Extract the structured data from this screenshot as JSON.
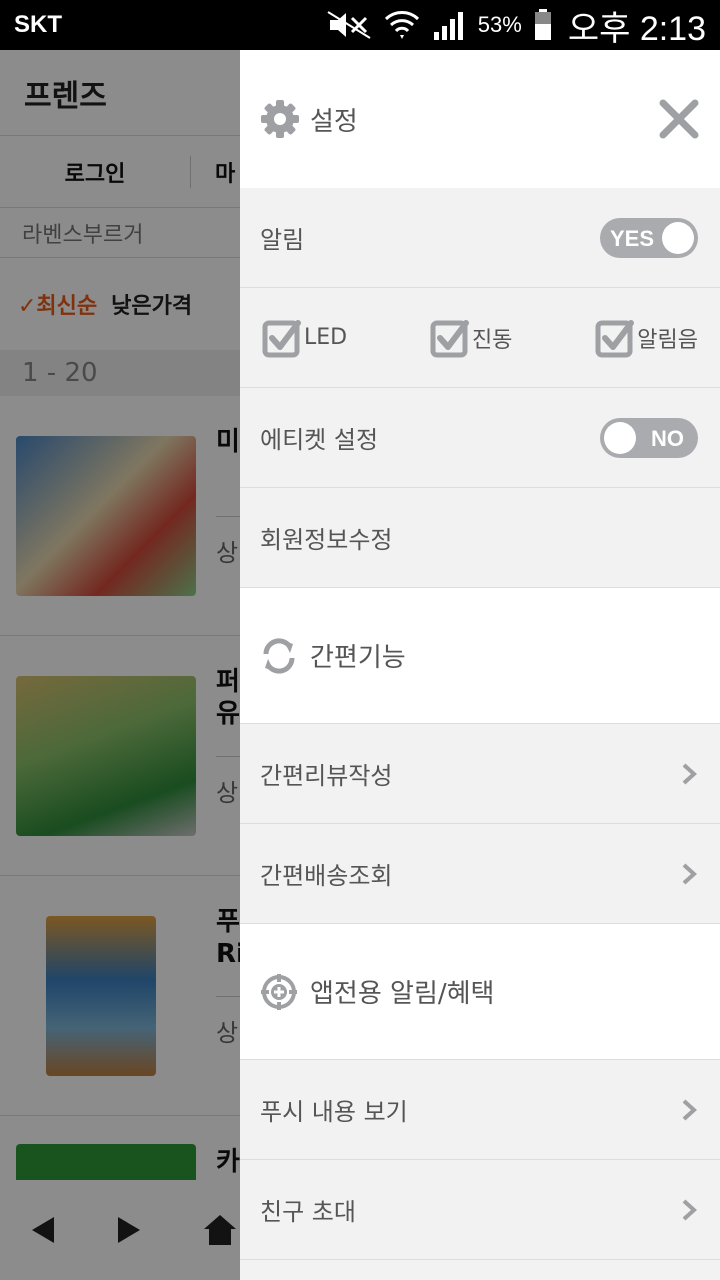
{
  "status_bar": {
    "carrier": "SKT",
    "battery": "53%",
    "time": "오후 2:13"
  },
  "background_page": {
    "header": "프렌즈",
    "tabs": [
      "로그인",
      "마"
    ],
    "search_text": "라벤스부르거",
    "sort": {
      "active": "✓최신순",
      "other": "낮은가격"
    },
    "range": "1 - 20",
    "items": [
      {
        "title": "미",
        "sub": "상"
      },
      {
        "title": "퍼\n유",
        "sub": "상"
      },
      {
        "title": "푸\nRi",
        "sub": "상"
      },
      {
        "title": "카",
        "sub": ""
      }
    ]
  },
  "drawer": {
    "settings": {
      "title": "설정",
      "icon": "gear-icon",
      "close_icon": "close-icon"
    },
    "notification": {
      "label": "알림",
      "toggle": "YES"
    },
    "options": [
      {
        "label": "LED"
      },
      {
        "label": "진동"
      },
      {
        "label": "알림음"
      }
    ],
    "etiquette": {
      "label": "에티켓 설정",
      "toggle": "NO"
    },
    "member_edit": {
      "label": "회원정보수정"
    },
    "quick": {
      "title": "간편기능",
      "icon": "refresh-icon",
      "items": [
        {
          "label": "간편리뷰작성"
        },
        {
          "label": "간편배송조회"
        }
      ]
    },
    "app_only": {
      "title": "앱전용 알림/혜택",
      "icon": "target-plus-icon",
      "items": [
        {
          "label": "푸시 내용 보기"
        },
        {
          "label": "친구 초대"
        }
      ]
    }
  },
  "colors": {
    "accent": "#e85b18",
    "toggle_bg": "#a9abae",
    "icon_grey": "#9ea0a3"
  }
}
